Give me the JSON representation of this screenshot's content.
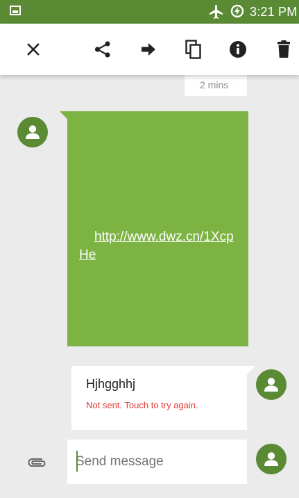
{
  "status_bar": {
    "time": "3:21 PM",
    "icons": [
      "gallery-notification-icon",
      "airplane-mode-icon",
      "battery-saver-icon"
    ]
  },
  "toolbar": {
    "actions": [
      "close-icon",
      "share-icon",
      "forward-icon",
      "copy-icon",
      "info-icon",
      "delete-icon"
    ]
  },
  "conversation": {
    "previous_timestamp": "2 mins",
    "incoming": {
      "link_text": "http://www.dwz.cn/1XcpHe"
    },
    "outgoing": {
      "text": "Hjhgghhj",
      "status": "Not sent. Touch to try again."
    }
  },
  "compose": {
    "placeholder": "Send message",
    "value": ""
  },
  "colors": {
    "status_bar": "#5a8a34",
    "bubble_incoming": "#7cb342",
    "avatar": "#5a8a34",
    "error": "#e53935",
    "background": "#ebebeb"
  }
}
